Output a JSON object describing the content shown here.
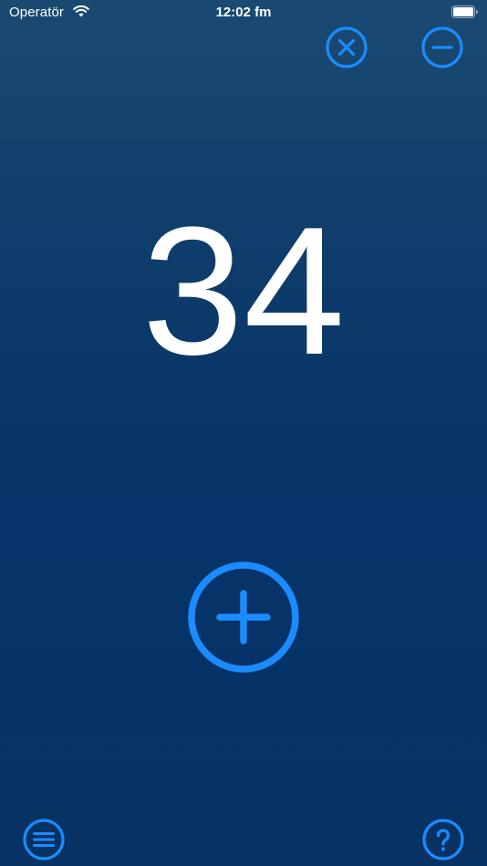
{
  "status_bar": {
    "carrier": "Operatör",
    "time": "12:02 fm",
    "icons": [
      "wifi-icon",
      "battery-icon"
    ]
  },
  "counter": {
    "value": "34"
  },
  "controls": {
    "reset": {
      "icon": "close-circle-icon"
    },
    "decrement": {
      "icon": "minus-circle-icon"
    },
    "increment": {
      "icon": "plus-circle-icon"
    },
    "menu": {
      "icon": "menu-circle-icon"
    },
    "help": {
      "icon": "question-circle-icon"
    }
  },
  "colors": {
    "accent": "#1a8cff",
    "background_top": "#1a4a72",
    "background_bottom": "#073263",
    "text": "#ffffff"
  }
}
